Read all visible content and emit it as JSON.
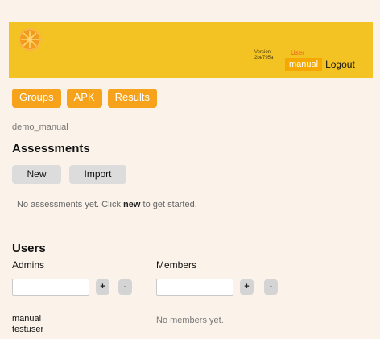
{
  "header": {
    "version_label": "Version",
    "version_value": "2be795a",
    "user_label": "User",
    "user_name": "manual",
    "logout_label": "Logout",
    "logo_icon": "orange-slice-icon",
    "colors": {
      "header_bg": "#f3c323",
      "accent": "#f6a21a",
      "user_label": "#f0601b"
    }
  },
  "nav": {
    "items": [
      {
        "label": "Groups"
      },
      {
        "label": "APK"
      },
      {
        "label": "Results"
      }
    ]
  },
  "project": {
    "name": "demo_manual"
  },
  "assessments": {
    "heading": "Assessments",
    "new_label": "New",
    "import_label": "Import",
    "empty_prefix": "No assessments yet. Click ",
    "empty_keyword": "new",
    "empty_suffix": " to get started."
  },
  "users": {
    "heading": "Users",
    "admins": {
      "label": "Admins",
      "input_value": "",
      "add_label": "+",
      "remove_label": "-",
      "list": [
        "manual",
        "testuser"
      ]
    },
    "members": {
      "label": "Members",
      "input_value": "",
      "add_label": "+",
      "remove_label": "-",
      "empty_text": "No members yet."
    }
  }
}
